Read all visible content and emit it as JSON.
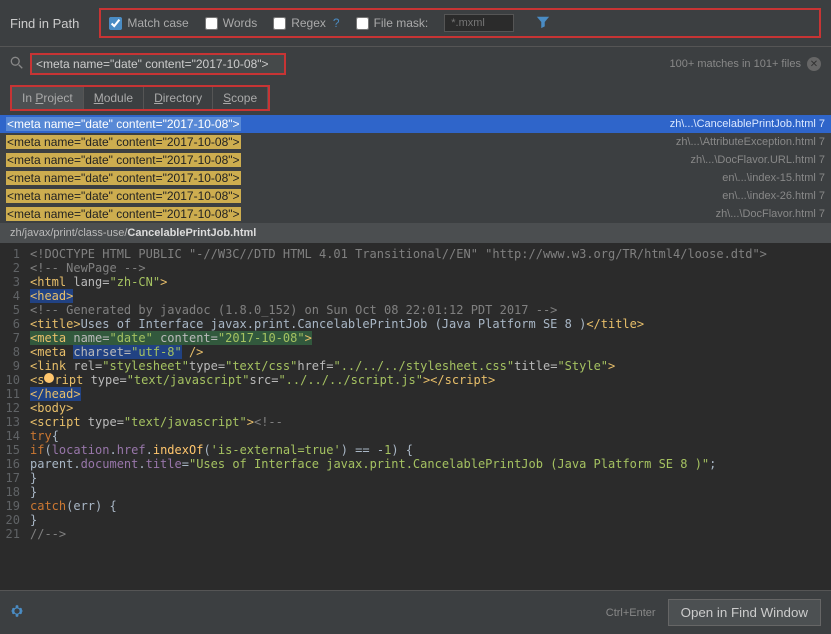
{
  "header": {
    "title": "Find in Path",
    "match_case": {
      "label": "Match case",
      "checked": true
    },
    "words": {
      "label": "Words",
      "checked": false
    },
    "regex": {
      "label": "Regex",
      "q": "?",
      "checked": false
    },
    "filemask": {
      "label": "File mask:",
      "placeholder": "*.mxml",
      "checked": false
    }
  },
  "search": {
    "query": "<meta name=\"date\" content=\"2017-10-08\">",
    "match_count": "100+ matches in 101+ files"
  },
  "scope": {
    "tabs": [
      "In Project",
      "Module",
      "Directory",
      "Scope"
    ],
    "active": 0
  },
  "results": [
    {
      "t": "<meta name=\"date\" content=\"2017-10-08\">",
      "p": "zh\\...\\CancelablePrintJob.html",
      "n": "7",
      "sel": true
    },
    {
      "t": "<meta name=\"date\" content=\"2017-10-08\">",
      "p": "zh\\...\\AttributeException.html",
      "n": "7"
    },
    {
      "t": "<meta name=\"date\" content=\"2017-10-08\">",
      "p": "zh\\...\\DocFlavor.URL.html",
      "n": "7"
    },
    {
      "t": "<meta name=\"date\" content=\"2017-10-08\">",
      "p": "en\\...\\index-15.html",
      "n": "7"
    },
    {
      "t": "<meta name=\"date\" content=\"2017-10-08\">",
      "p": "en\\...\\index-26.html",
      "n": "7"
    },
    {
      "t": "<meta name=\"date\" content=\"2017-10-08\">",
      "p": "zh\\...\\DocFlavor.html",
      "n": "7"
    }
  ],
  "open_file_prefix": "zh/javax/print/class-use/",
  "open_file_name": "CancelablePrintJob.html",
  "footer": {
    "hint": "Ctrl+Enter",
    "button": "Open in Find Window"
  }
}
